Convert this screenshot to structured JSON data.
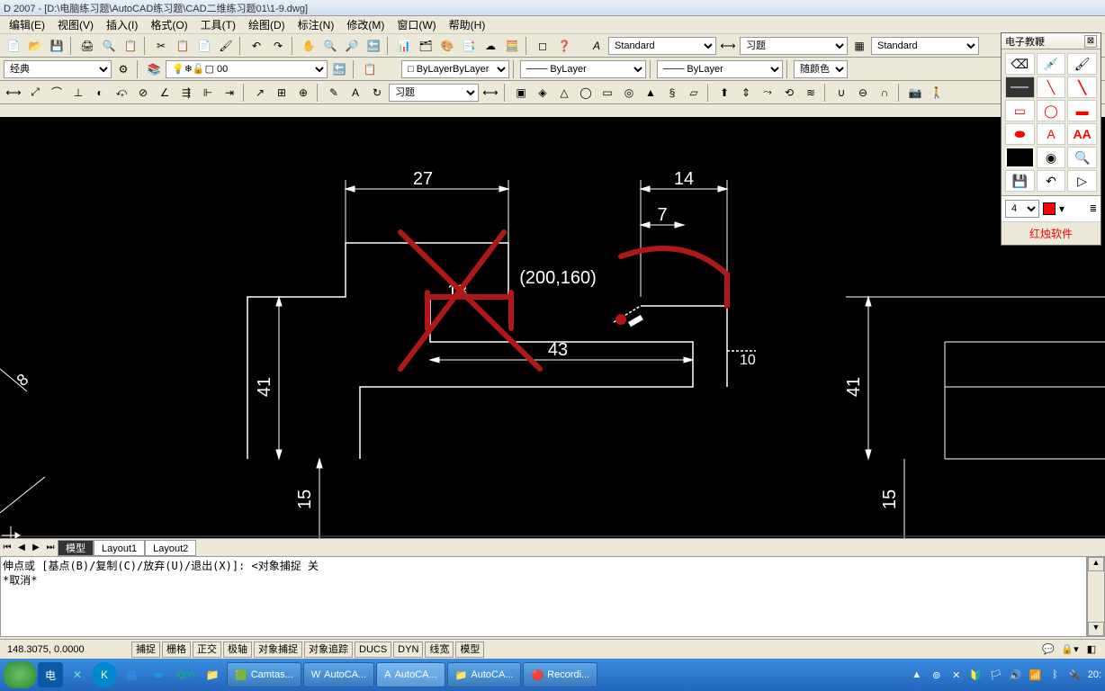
{
  "titlebar": {
    "text": "D 2007 - [D:\\电脑练习题\\AutoCAD练习题\\CAD二维练习题01\\1-9.dwg]"
  },
  "menu": {
    "edit": "编辑(E)",
    "view": "视图(V)",
    "insert": "插入(I)",
    "format": "格式(O)",
    "tools": "工具(T)",
    "draw": "绘图(D)",
    "dimension": "标注(N)",
    "modify": "修改(M)",
    "window": "窗口(W)",
    "help": "帮助(H)"
  },
  "combos": {
    "textstyle": "Standard",
    "dimstyle": "习题",
    "tablestyle": "Standard",
    "workspace": "经典",
    "layer": "0",
    "color": "ByLayer",
    "linetype": "ByLayer",
    "lineweight": "ByLayer",
    "plotstyle": "随颜色",
    "filter": "习题"
  },
  "side": {
    "title": "电子教鞭",
    "line_sw": "4",
    "footer_text": "红烛软件"
  },
  "tabs": {
    "model": "模型",
    "layout1": "Layout1",
    "layout2": "Layout2"
  },
  "cmd": {
    "line1": "伸点或  [基点(B)/复制(C)/放弃(U)/退出(X)]:   <对象捕捉 关",
    "line2": "*取消*"
  },
  "status": {
    "coords": "148.3075, 0.0000",
    "snap": "捕捉",
    "grid": "栅格",
    "ortho": "正交",
    "polar": "极轴",
    "osnap": "对象捕捉",
    "otrack": "对象追踪",
    "ducs": "DUCS",
    "dyn": "DYN",
    "lwt": "线宽",
    "model": "模型"
  },
  "task": {
    "camtasia": "Camtas...",
    "word": "AutoCA...",
    "acad": "AutoCA...",
    "explorer": "AutoCA...",
    "recorder": "Recordi...",
    "time": "20:"
  },
  "drawing": {
    "dim27": "27",
    "dim14": "14",
    "dim7": "7",
    "dim13": "13",
    "dim43": "43",
    "coord": "(200,160)",
    "dim41l": "41",
    "dim41r": "41",
    "dim15l": "15",
    "dim15r": "15",
    "dim8": "8",
    "dim10": "10"
  }
}
